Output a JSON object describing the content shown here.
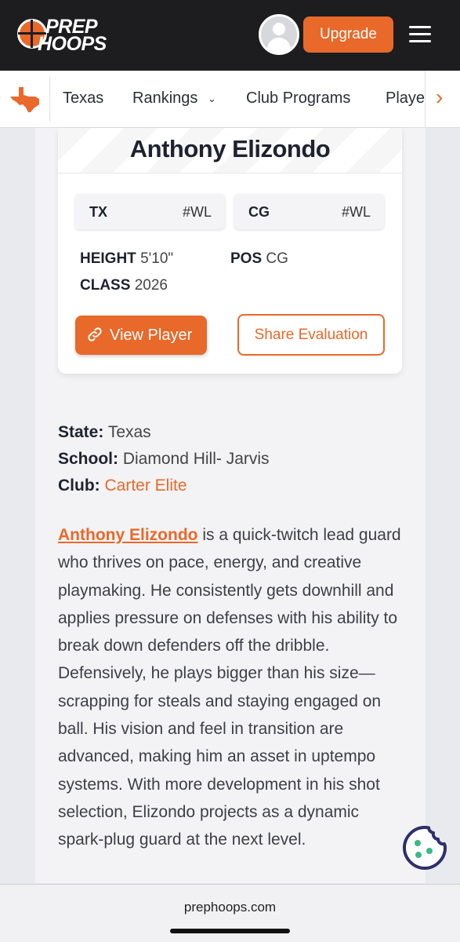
{
  "header": {
    "logo_line1": "PREP",
    "logo_line2": "HOOPS",
    "upgrade_label": "Upgrade"
  },
  "nav": {
    "items": [
      "Texas",
      "Rankings",
      "Club Programs",
      "Playe"
    ],
    "rankings_has_dropdown": true
  },
  "player_card": {
    "name": "Anthony Elizondo",
    "chips": [
      {
        "key": "TX",
        "value": "#WL"
      },
      {
        "key": "CG",
        "value": "#WL"
      }
    ],
    "height_label": "HEIGHT",
    "height_value": "5'10\"",
    "pos_label": "POS",
    "pos_value": "CG",
    "class_label": "CLASS",
    "class_value": "2026",
    "view_button": "View Player",
    "share_button": "Share Evaluation"
  },
  "details": {
    "state_label": "State:",
    "state_value": "Texas",
    "school_label": "School:",
    "school_value": "Diamond Hill- Jarvis",
    "club_label": "Club:",
    "club_value": "Carter Elite"
  },
  "bio": {
    "name_link": "Anthony Elizondo",
    "text": " is a quick-twitch lead guard who thrives on pace, energy, and creative playmaking. He consistently gets downhill and applies pressure on defenses with his ability to break down defenders off the dribble. Defensively, he plays bigger than his size—scrapping for steals and staying engaged on ball. His vision and feel in transition are advanced, making him an asset in uptempo systems. With more development in his shot selection, Elizondo projects as a dynamic spark-plug guard at the next level."
  },
  "footer": {
    "url": "prephoops.com"
  },
  "colors": {
    "accent": "#e8692a",
    "topbar": "#1d1d1f",
    "cookie": "#2e2f6b"
  }
}
